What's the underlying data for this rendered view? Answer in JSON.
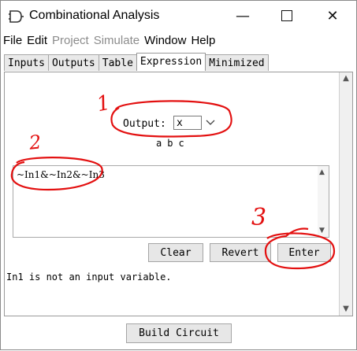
{
  "window": {
    "title": "Combinational Analysis",
    "controls": {
      "minimize": "—",
      "close": "✕"
    }
  },
  "menu": [
    {
      "label": "File",
      "enabled": true
    },
    {
      "label": "Edit",
      "enabled": true
    },
    {
      "label": "Project",
      "enabled": false
    },
    {
      "label": "Simulate",
      "enabled": false
    },
    {
      "label": "Window",
      "enabled": true
    },
    {
      "label": "Help",
      "enabled": true
    }
  ],
  "tabs": [
    "Inputs",
    "Outputs",
    "Table",
    "Expression",
    "Minimized"
  ],
  "active_tab": "Expression",
  "expression_panel": {
    "output_label": "Output:",
    "output_value": "x",
    "variables": [
      "a",
      "b",
      "c"
    ],
    "expression_text": "~In1&~In2&~In3",
    "buttons": {
      "clear": "Clear",
      "revert": "Revert",
      "enter": "Enter"
    },
    "status": "In1 is not an input variable."
  },
  "build_button": "Build Circuit",
  "annotations": {
    "step1": "1",
    "step2": "2",
    "step3": "3",
    "color": "#e31010"
  },
  "icons": {
    "dropdown": "chevron-down-icon",
    "scroll_up": "arrow-up-icon",
    "scroll_down": "arrow-down-icon"
  }
}
